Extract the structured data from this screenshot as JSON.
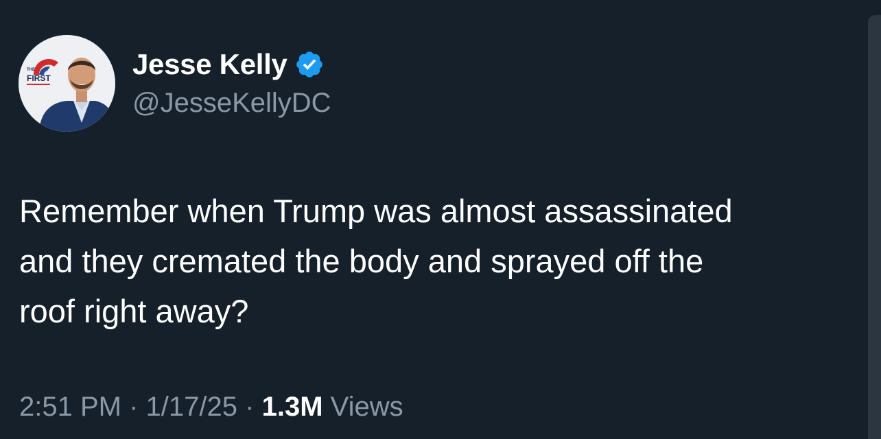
{
  "author": {
    "display_name": "Jesse Kelly",
    "handle": "@JesseKellyDC",
    "verified": true,
    "verified_color": "#1d9bf0",
    "avatar_badge": {
      "line1": "THE",
      "line2": "FIRST"
    }
  },
  "tweet": {
    "lines": [
      "Remember when Trump was almost assassinated",
      "and they cremated the body and sprayed off the",
      "roof right away?"
    ]
  },
  "meta": {
    "time": "2:51 PM",
    "separator": "·",
    "date": "1/17/25",
    "views_count": "1.3M",
    "views_label": "Views"
  },
  "theme": {
    "background": "#15202b",
    "text_primary": "#ffffff",
    "text_secondary": "#8b98a5"
  }
}
